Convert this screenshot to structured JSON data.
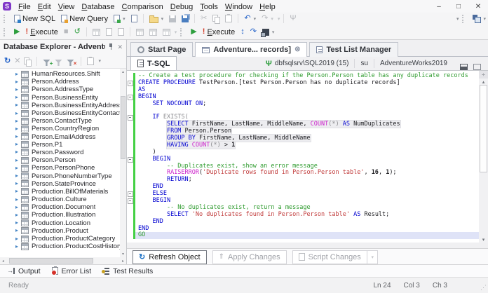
{
  "menu": {
    "items": [
      "File",
      "Edit",
      "View",
      "Database",
      "Comparison",
      "Debug",
      "Tools",
      "Window",
      "Help"
    ]
  },
  "window_controls": {
    "minimize": "–",
    "maximize": "□",
    "close": "✕"
  },
  "app_icon_letter": "S",
  "toolbar": {
    "new_sql": "New SQL",
    "new_query": "New Query",
    "execute": "Execute"
  },
  "explorer": {
    "title": "Database Explorer - Adventure...",
    "items": [
      "HumanResources.Shift",
      "Person.Address",
      "Person.AddressType",
      "Person.BusinessEntity",
      "Person.BusinessEntityAddress",
      "Person.BusinessEntityContact",
      "Person.ContactType",
      "Person.CountryRegion",
      "Person.EmailAddress",
      "Person.P1",
      "Person.Password",
      "Person.Person",
      "Person.PersonPhone",
      "Person.PhoneNumberType",
      "Person.StateProvince",
      "Production.BillOfMaterials",
      "Production.Culture",
      "Production.Document",
      "Production.Illustration",
      "Production.Location",
      "Production.Product",
      "Production.ProductCategory",
      "Production.ProductCostHistory"
    ]
  },
  "doc_tabs": [
    {
      "label": "Start Page",
      "icon": "start-page-icon",
      "closable": false,
      "active": false
    },
    {
      "label": "Adventure... records]",
      "icon": "sql-document-icon",
      "closable": true,
      "active": true
    },
    {
      "label": "Test List Manager",
      "icon": "test-list-icon",
      "closable": false,
      "active": false
    }
  ],
  "editor": {
    "tab": "T-SQL",
    "connection": {
      "server": "dbfsqlsrv\\SQL2019 (15)",
      "user": "su",
      "database": "AdventureWorks2019"
    },
    "current_line": 24,
    "fold_lines": [
      2,
      4,
      7,
      13,
      18,
      19
    ],
    "box_lines": [
      8,
      9,
      10,
      11
    ],
    "lines": [
      [
        [
          "c",
          "-- Create a test procedure for checking if the Person.Person table has any duplicate records"
        ]
      ],
      [
        [
          "k",
          "CREATE PROCEDURE"
        ],
        [
          "t",
          " TestPerson.[test Person.Person has no duplicate records]"
        ]
      ],
      [
        [
          "k",
          "AS"
        ]
      ],
      [
        [
          "k",
          "BEGIN"
        ]
      ],
      [
        [
          "t",
          "    "
        ],
        [
          "k",
          "SET NOCOUNT ON"
        ],
        [
          "t",
          ";"
        ]
      ],
      [],
      [
        [
          "t",
          "    "
        ],
        [
          "k",
          "IF"
        ],
        [
          "t",
          " "
        ],
        [
          "g",
          "EXISTS("
        ]
      ],
      [
        [
          "t",
          "        "
        ],
        [
          "k",
          "SELECT"
        ],
        [
          "t",
          " FirstName, LastName, MiddleName, "
        ],
        [
          "m",
          "COUNT"
        ],
        [
          "g",
          "(*)"
        ],
        [
          "t",
          " "
        ],
        [
          "k",
          "AS"
        ],
        [
          "t",
          " NumDuplicates"
        ]
      ],
      [
        [
          "t",
          "        "
        ],
        [
          "k",
          "FROM"
        ],
        [
          "t",
          " Person.Person"
        ]
      ],
      [
        [
          "t",
          "        "
        ],
        [
          "k",
          "GROUP BY"
        ],
        [
          "t",
          " FirstName, LastName, MiddleName"
        ]
      ],
      [
        [
          "t",
          "        "
        ],
        [
          "k",
          "HAVING"
        ],
        [
          "t",
          " "
        ],
        [
          "m",
          "COUNT"
        ],
        [
          "g",
          "(*)"
        ],
        [
          "t",
          " > "
        ],
        [
          "n",
          "1"
        ]
      ],
      [
        [
          "t",
          "    )"
        ]
      ],
      [
        [
          "t",
          "    "
        ],
        [
          "k",
          "BEGIN"
        ]
      ],
      [
        [
          "t",
          "        "
        ],
        [
          "c",
          "-- Duplicates exist, show an error message"
        ]
      ],
      [
        [
          "t",
          "        "
        ],
        [
          "m",
          "RAISERROR"
        ],
        [
          "t",
          "("
        ],
        [
          "s",
          "'Duplicate rows found in Person.Person table'"
        ],
        [
          "t",
          ", "
        ],
        [
          "n",
          "16"
        ],
        [
          "t",
          ", "
        ],
        [
          "n",
          "1"
        ],
        [
          "t",
          ");"
        ]
      ],
      [
        [
          "t",
          "        "
        ],
        [
          "k",
          "RETURN"
        ],
        [
          "t",
          ";"
        ]
      ],
      [
        [
          "t",
          "    "
        ],
        [
          "k",
          "END"
        ]
      ],
      [
        [
          "t",
          "    "
        ],
        [
          "k",
          "ELSE"
        ]
      ],
      [
        [
          "t",
          "    "
        ],
        [
          "k",
          "BEGIN"
        ]
      ],
      [
        [
          "t",
          "        "
        ],
        [
          "c",
          "-- No duplicates exist, return a message"
        ]
      ],
      [
        [
          "t",
          "        "
        ],
        [
          "k",
          "SELECT"
        ],
        [
          "t",
          " "
        ],
        [
          "s",
          "'No duplicates found in Person.Person table'"
        ],
        [
          "t",
          " "
        ],
        [
          "k",
          "AS"
        ],
        [
          "t",
          " Result;"
        ]
      ],
      [
        [
          "t",
          "    "
        ],
        [
          "k",
          "END"
        ]
      ],
      [
        [
          "k",
          "END"
        ]
      ],
      [
        [
          "go",
          "GO"
        ]
      ]
    ]
  },
  "actions": {
    "refresh": "Refresh Object",
    "apply": "Apply Changes",
    "script": "Script Changes"
  },
  "bottom_tabs": [
    {
      "label": "Output",
      "icon": "output-icon"
    },
    {
      "label": "Error List",
      "icon": "errorlist-icon"
    },
    {
      "label": "Test Results",
      "icon": "testresults-icon"
    }
  ],
  "status": {
    "state": "Ready",
    "ln": "Ln 24",
    "col": "Col 3",
    "ch": "Ch 3"
  },
  "colors": {
    "keyword": "#0000d0",
    "comment": "#2e9b2e",
    "string": "#c13b3b",
    "function": "#cc22cc",
    "change_bar": "#44d044",
    "current_line_bg": "#dfe3f7",
    "accent_green": "#2e9e3e",
    "accent_blue": "#2060c8",
    "app_icon": "#8038c8"
  },
  "icons": {
    "play": "▶",
    "stop": "■",
    "exclaim": "!",
    "history": "↺",
    "undo": "↶",
    "redo": "↷",
    "caret": "▾",
    "refresh": "↻",
    "close": "✕",
    "plug": "Ψ",
    "cut": "✂",
    "updown": "↕",
    "tree_arrow": "▸",
    "up": "▴",
    "down": "▾",
    "left": "◂",
    "right": "▸",
    "close_circle": "⊗",
    "splitter": "÷",
    "grip_dots": "⋰",
    "output_arrow": "→"
  }
}
